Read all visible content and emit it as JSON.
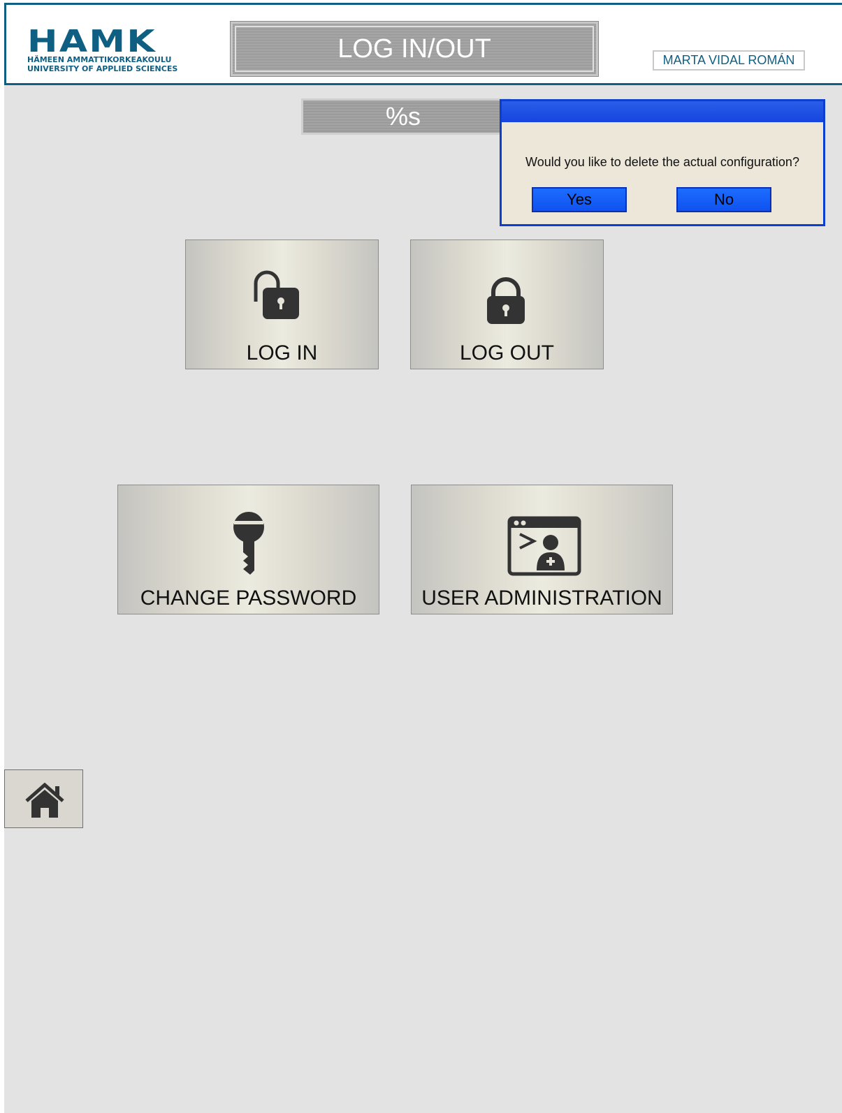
{
  "header": {
    "logo": {
      "name": "HAMK",
      "line1": "HÄMEEN AMMATTIKORKEAKOULU",
      "line2": "UNIVERSITY OF APPLIED SCIENCES"
    },
    "title": "LOG IN/OUT",
    "user_name": "MARTA VIDAL ROMÁN"
  },
  "status": {
    "text": "%s"
  },
  "dialog": {
    "message": "Would you like to delete the actual configuration?",
    "yes_label": "Yes",
    "no_label": "No"
  },
  "tiles": {
    "log_in": {
      "label": "LOG IN",
      "icon": "unlock-icon"
    },
    "log_out": {
      "label": "LOG OUT",
      "icon": "lock-icon"
    },
    "change_password": {
      "label": "CHANGE PASSWORD",
      "icon": "key-icon"
    },
    "user_administration": {
      "label": "USER ADMINISTRATION",
      "icon": "user-admin-icon"
    }
  },
  "nav": {
    "home_icon": "home-icon"
  },
  "colors": {
    "brand": "#0f5f83",
    "background": "#e3e3e3",
    "dialog_accent": "#1544e0",
    "icon": "#333333"
  }
}
